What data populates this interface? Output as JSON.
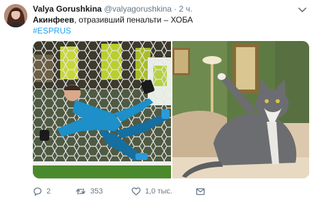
{
  "tweet": {
    "display_name": "Valya Gorushkina",
    "handle": "@valyagorushkina",
    "separator": "·",
    "time": "2 ч.",
    "text_bold": "Акинфеев",
    "text_rest": ", отразивший пенальти – ХОБА",
    "hashtag": "#ESPRUS"
  },
  "actions": {
    "reply_count": "2",
    "retweet_count": "353",
    "like_count": "1,0 тыс."
  },
  "icons": {
    "more": "chevron-down-icon",
    "reply": "reply-icon",
    "retweet": "retweet-icon",
    "like": "heart-icon",
    "message": "envelope-icon"
  },
  "colors": {
    "link": "#1da1f2",
    "secondary_text": "#657786",
    "primary_text": "#14171a"
  }
}
